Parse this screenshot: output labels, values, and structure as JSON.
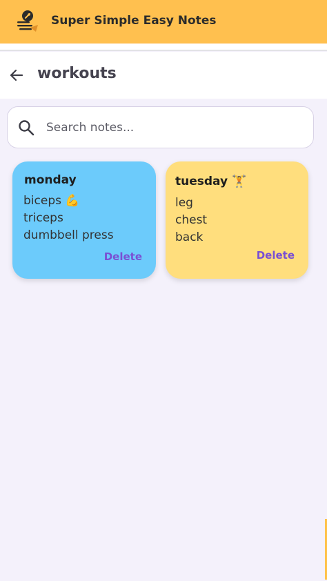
{
  "app": {
    "title": "Super Simple Easy Notes",
    "brand_color": "#ffc04f",
    "logo_icon": "notes-logo-icon"
  },
  "page": {
    "title": "workouts",
    "back_icon": "arrow-left-icon"
  },
  "search": {
    "placeholder": "Search notes...",
    "value": "",
    "icon": "search-icon"
  },
  "notes": [
    {
      "title": "monday",
      "body": "biceps 💪\ntriceps\ndumbbell press",
      "color": "#6ccbfb",
      "delete_label": "Delete"
    },
    {
      "title": "tuesday 🏋️",
      "body": "leg\nchest\nback",
      "color": "#ffde7d",
      "delete_label": "Delete"
    }
  ],
  "colors": {
    "accent": "#7a4fd3",
    "background": "#f4f1fb"
  }
}
